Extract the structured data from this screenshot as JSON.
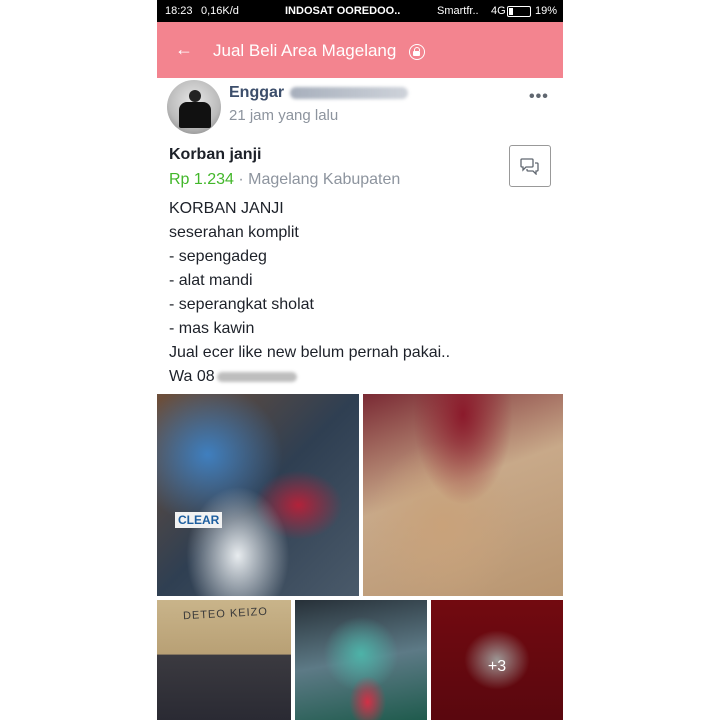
{
  "status_bar": {
    "time": "18:23",
    "speed": "0,16K/d",
    "carrier1": "INDOSAT OOREDOO..",
    "carrier2": "Smartfr..",
    "network": "4G",
    "battery": "19%"
  },
  "app_bar": {
    "title": "Jual Beli Area Magelang",
    "back_icon": "arrow-left-icon",
    "lock_icon": "lock-icon"
  },
  "post": {
    "author": "Enggar",
    "time_ago": "21 jam yang lalu",
    "more_icon": "more-dots-icon",
    "title": "Korban janji",
    "price": "Rp 1.234",
    "separator": "·",
    "location": "Magelang Kabupaten",
    "description": [
      "KORBAN JANJI",
      "seserahan komplit",
      "- sepengadeg",
      "- alat mandi",
      "- seperangkat sholat",
      "- mas kawin",
      "Jual ecer like new belum pernah pakai..",
      "Wa 08"
    ],
    "photos": {
      "extra_count": "+3",
      "box_text": "DETEO KEIZO",
      "shampoo_text": "CLEAR"
    }
  },
  "colors": {
    "app_bar": "#f3848f",
    "price": "#42b72a",
    "author": "#3c4e6b",
    "muted": "#8d949e"
  }
}
